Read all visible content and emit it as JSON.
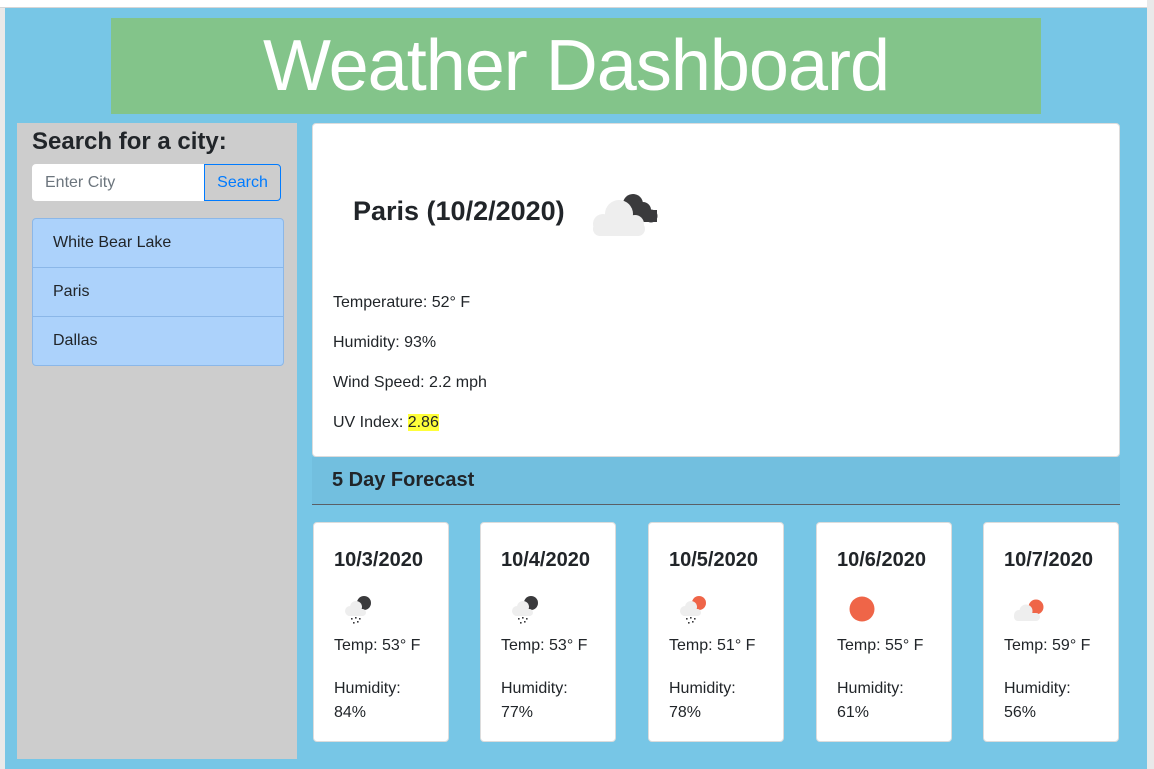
{
  "header": {
    "title": "Weather Dashboard"
  },
  "sidebar": {
    "heading": "Search for a city:",
    "search": {
      "placeholder": "Enter City",
      "value": "",
      "button_label": "Search"
    },
    "cities": [
      {
        "label": "White Bear Lake"
      },
      {
        "label": "Paris"
      },
      {
        "label": "Dallas"
      }
    ]
  },
  "current": {
    "title": "Paris (10/2/2020)",
    "icon": "cloudy-night-icon",
    "temperature": "Temperature: 52° F",
    "humidity": "Humidity: 93%",
    "wind": "Wind Speed: 2.2 mph",
    "uv_label": "UV Index: ",
    "uv_value": "2.86",
    "uv_color": "#ffff3a"
  },
  "forecast": {
    "heading": "5 Day Forecast",
    "days": [
      {
        "date": "10/3/2020",
        "icon": "rain-night-icon",
        "temp": "Temp: 53° F",
        "humidity_label": "Humidity:",
        "humidity": "84%"
      },
      {
        "date": "10/4/2020",
        "icon": "rain-night-icon",
        "temp": "Temp: 53° F",
        "humidity_label": "Humidity:",
        "humidity": "77%"
      },
      {
        "date": "10/5/2020",
        "icon": "rain-day-icon",
        "temp": "Temp: 51° F",
        "humidity_label": "Humidity:",
        "humidity": "78%"
      },
      {
        "date": "10/6/2020",
        "icon": "sun-icon",
        "temp": "Temp: 55° F",
        "humidity_label": "Humidity:",
        "humidity": "61%"
      },
      {
        "date": "10/7/2020",
        "icon": "partly-cloudy-day-icon",
        "temp": "Temp: 59° F",
        "humidity_label": "Humidity:",
        "humidity": "56%"
      }
    ]
  },
  "colors": {
    "page_bg": "#77c6e6",
    "header_bg": "#83c48a",
    "sidebar_bg": "#cdcdcd",
    "city_item_bg": "#acd2fb",
    "button_accent": "#007bff",
    "sun": "#ef6548",
    "dark_cloud": "#3a3a3c",
    "light_cloud": "#eeeeee"
  }
}
